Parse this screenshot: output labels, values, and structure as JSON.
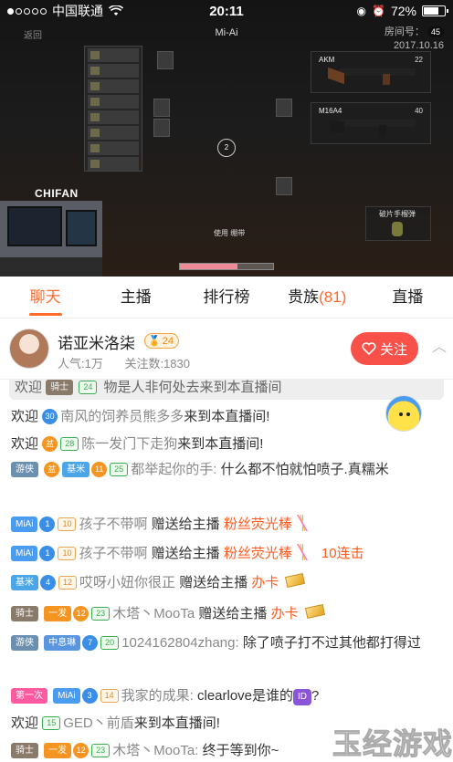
{
  "status_bar": {
    "carrier": "中国联通",
    "time": "20:11",
    "battery": "72%",
    "battery_level": 0.72
  },
  "video": {
    "title": "Mi-Ai",
    "back_label": "返回",
    "room_label": "房间号：",
    "date": "2017.10.16",
    "room_badge": "45",
    "cam_label": "CHIFAN",
    "weapon1": {
      "name": "AKM",
      "ammo": "22"
    },
    "weapon2": {
      "name": "M16A4",
      "ammo": "40"
    },
    "grenade": "破片手榴弹",
    "bandage_hint": "使用 绷带",
    "health_fraction": 0.62
  },
  "tabs": [
    {
      "label": "聊天",
      "active": true
    },
    {
      "label": "主播",
      "active": false
    },
    {
      "label": "排行榜",
      "active": false
    },
    {
      "label": "贵族",
      "count": "(81)",
      "active": false
    },
    {
      "label": "直播",
      "active": false
    }
  ],
  "anchor": {
    "name": "诺亚米洛柒",
    "level": "24",
    "popularity": "人气:1万",
    "followers": "关注数:1830",
    "follow_label": "关注"
  },
  "chat": {
    "pinned": {
      "prefix": "欢迎",
      "badge": "骑士",
      "fan": "24",
      "text": "物是人非何处去来到本直播间"
    },
    "messages": [
      {
        "id": "m1",
        "prefix": "欢迎",
        "level": "30",
        "user": "南风的饲养员熊多多",
        "text": "来到本直播间!"
      },
      {
        "id": "m2",
        "prefix": "欢迎",
        "fan_label": "28",
        "user": "陈一发门下走狗",
        "text": "来到本直播间!"
      },
      {
        "id": "m3",
        "noble": "游侠",
        "club": "基米",
        "club_lv": "11",
        "fan": "25",
        "user": "都举起你的手:",
        "text": "什么都不怕就怕喷子.真糯米"
      },
      {
        "id": "m4",
        "club": "MiAi",
        "club_lv": "1",
        "fan": "10",
        "user": "孩子不带啊",
        "action": "赠送给主播",
        "gift": "粉丝荧光棒"
      },
      {
        "id": "m5",
        "club": "MiAi",
        "club_lv": "1",
        "fan": "10",
        "user": "孩子不带啊",
        "action": "赠送给主播",
        "gift": "粉丝荧光棒",
        "combo": "10连击"
      },
      {
        "id": "m6",
        "club": "基米",
        "club_lv": "4",
        "fan": "12",
        "user": "哎呀小妞你很正",
        "action": "赠送给主播",
        "gift": "办卡"
      },
      {
        "id": "m7",
        "noble": "骑士",
        "club": "一发",
        "club_lv": "12",
        "fan": "23",
        "user": "木塔丶MooTa",
        "action": "赠送给主播",
        "gift": "办卡"
      },
      {
        "id": "m8",
        "noble": "游侠",
        "club": "中息琳",
        "club_lv": "7",
        "fan": "20",
        "user": "1024162804zhang:",
        "text": "除了喷子打不过其他都打得过"
      },
      {
        "id": "m9",
        "tag": "第一次",
        "club": "MiAi",
        "club_lv": "3",
        "fan": "14",
        "user": "我家的成果:",
        "text": "clearlove是谁的",
        "text_tail": "?"
      },
      {
        "id": "m10",
        "prefix": "欢迎",
        "fan": "15",
        "user": "GED丶前盾",
        "text": "来到本直播间!"
      },
      {
        "id": "m11",
        "noble": "骑士",
        "club": "一发",
        "club_lv": "12",
        "fan": "23",
        "user": "木塔丶MooTa:",
        "text": "终于等到你~"
      }
    ]
  },
  "watermark": "玉经游戏",
  "colors": {
    "accent": "#ff6a2a",
    "follow": "#f8514a",
    "gift": "#ff5a1f"
  },
  "icons": {
    "follow": "heart-plus-icon",
    "collapse": "chevron-up-icon",
    "wifi": "wifi-icon",
    "id": "id-emoji-icon"
  }
}
